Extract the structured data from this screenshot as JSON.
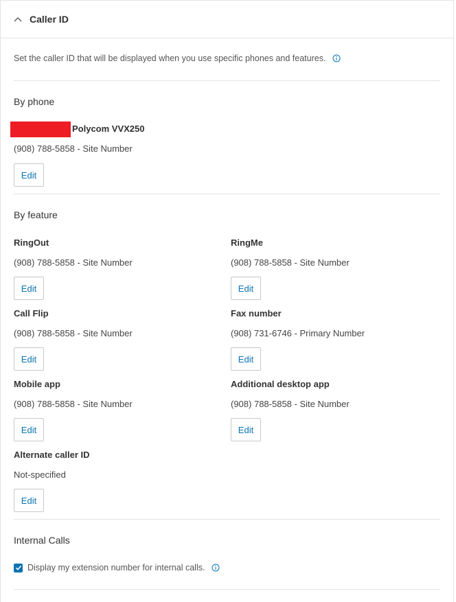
{
  "header": {
    "title": "Caller ID"
  },
  "description": "Set the caller ID that will be displayed when you use specific phones and features.",
  "by_phone": {
    "title": "By phone",
    "device_name": "Polycom VVX250",
    "number": "(908) 788-5858 - Site Number",
    "edit_label": "Edit"
  },
  "by_feature": {
    "title": "By feature",
    "items": [
      {
        "name": "RingOut",
        "value": "(908) 788-5858 - Site Number",
        "edit_label": "Edit"
      },
      {
        "name": "RingMe",
        "value": "(908) 788-5858 - Site Number",
        "edit_label": "Edit"
      },
      {
        "name": "Call Flip",
        "value": "(908) 788-5858 - Site Number",
        "edit_label": "Edit"
      },
      {
        "name": "Fax number",
        "value": "(908) 731-6746 - Primary Number",
        "edit_label": "Edit"
      },
      {
        "name": "Mobile app",
        "value": "(908) 788-5858 - Site Number",
        "edit_label": "Edit"
      },
      {
        "name": "Additional desktop app",
        "value": "(908) 788-5858 - Site Number",
        "edit_label": "Edit"
      },
      {
        "name": "Alternate caller ID",
        "value": "Not-specified",
        "edit_label": "Edit"
      }
    ]
  },
  "internal_calls": {
    "title": "Internal Calls",
    "checkbox_label": "Display my extension number for internal calls.",
    "checked": true
  },
  "colors": {
    "accent": "#0a73b0",
    "redaction": "#ee1c25",
    "divider": "#e3e3e3"
  },
  "icons": {
    "collapse": "chevron-up-icon",
    "info": "info-icon",
    "check": "check-icon"
  }
}
